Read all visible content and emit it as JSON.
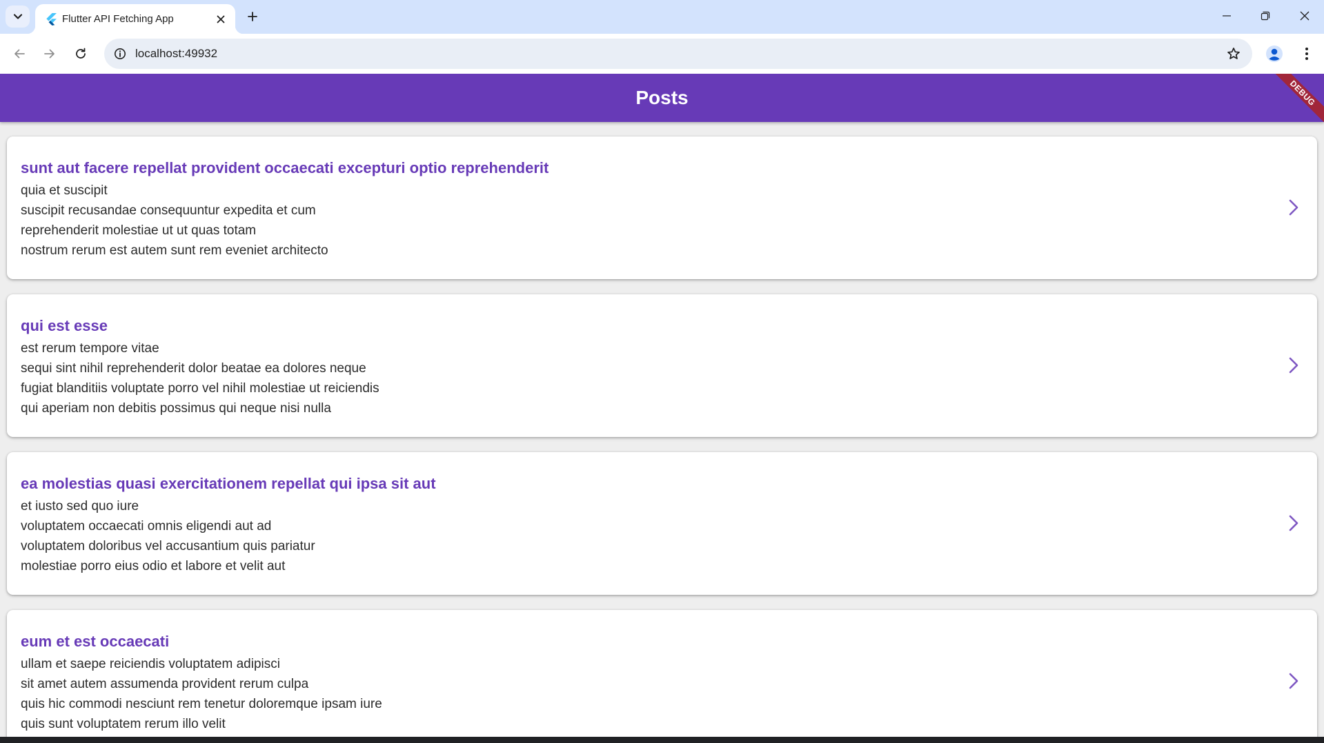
{
  "browser": {
    "tab": {
      "title": "Flutter API Fetching App",
      "favicon": "flutter-logo-icon"
    },
    "url": "localhost:49932"
  },
  "app": {
    "title": "Posts",
    "debug_banner": "DEBUG",
    "accent_color": "#673ab7",
    "posts": [
      {
        "title": "sunt aut facere repellat provident occaecati excepturi optio reprehenderit",
        "body": "quia et suscipit\nsuscipit recusandae consequuntur expedita et cum\nreprehenderit molestiae ut ut quas totam\nnostrum rerum est autem sunt rem eveniet architecto"
      },
      {
        "title": "qui est esse",
        "body": "est rerum tempore vitae\nsequi sint nihil reprehenderit dolor beatae ea dolores neque\nfugiat blanditiis voluptate porro vel nihil molestiae ut reiciendis\nqui aperiam non debitis possimus qui neque nisi nulla"
      },
      {
        "title": "ea molestias quasi exercitationem repellat qui ipsa sit aut",
        "body": "et iusto sed quo iure\nvoluptatem occaecati omnis eligendi aut ad\nvoluptatem doloribus vel accusantium quis pariatur\nmolestiae porro eius odio et labore et velit aut"
      },
      {
        "title": "eum et est occaecati",
        "body": "ullam et saepe reiciendis voluptatem adipisci\nsit amet autem assumenda provident rerum culpa\nquis hic commodi nesciunt rem tenetur doloremque ipsam iure\nquis sunt voluptatem rerum illo velit"
      }
    ]
  }
}
